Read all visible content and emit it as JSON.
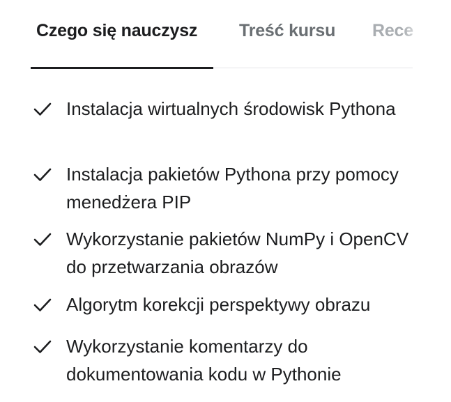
{
  "tabs": [
    {
      "label": "Czego się nauczysz",
      "active": true
    },
    {
      "label": "Treść kursu",
      "active": false
    },
    {
      "label": "Rece",
      "active": false
    }
  ],
  "learning_points": [
    "Instalacja wirtualnych środowisk Pythona",
    "Instalacja pakietów Pythona przy pomocy menedżera PIP",
    "Wykorzystanie pakietów NumPy i OpenCV do przetwarzania obrazów",
    "Algorytm korekcji perspektywy obrazu",
    "Wykorzystanie komentarzy do dokumentowania kodu w Pythonie"
  ],
  "icons": {
    "bullet": "checkmark-icon"
  },
  "colors": {
    "text": "#1c1d1f",
    "inactive_tab": "#6a6f73",
    "divider": "#e4e6e8"
  }
}
